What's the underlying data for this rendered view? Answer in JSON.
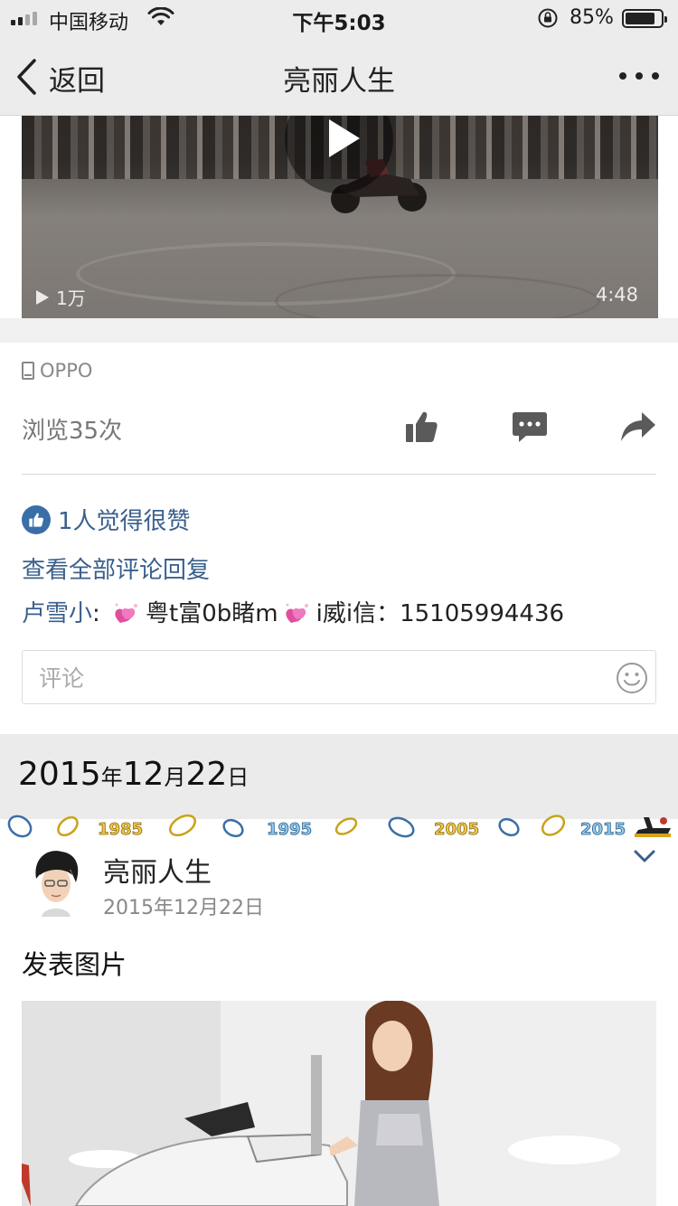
{
  "status_bar": {
    "carrier": "中国移动",
    "time": "下午5:03",
    "battery_pct": "85%",
    "battery_level": 0.85
  },
  "nav": {
    "back_label": "返回",
    "title": "亮丽人生"
  },
  "video": {
    "views": "1万",
    "duration": "4:48"
  },
  "post": {
    "device": "OPPO",
    "browse_count": "浏览35次",
    "likes_text": "1人觉得很赞",
    "view_all_comments": "查看全部评论回复",
    "comment": {
      "author": "卢雪小",
      "separator": ": ",
      "text_part1": "粤t富0b睹m",
      "text_part2": "i威i信：15105994436"
    },
    "comment_placeholder": "评论"
  },
  "date_section": {
    "year": "2015",
    "year_unit": "年",
    "month": "12",
    "month_unit": "月",
    "day": "22",
    "day_unit": "日"
  },
  "deco_years": [
    "1985",
    "1995",
    "2005",
    "2015"
  ],
  "next_post": {
    "author": "亮丽人生",
    "date": "2015年12月22日",
    "text": "发表图片"
  },
  "colors": {
    "link_blue": "#3a5f8c",
    "icon_gray": "#5a5a5a"
  }
}
